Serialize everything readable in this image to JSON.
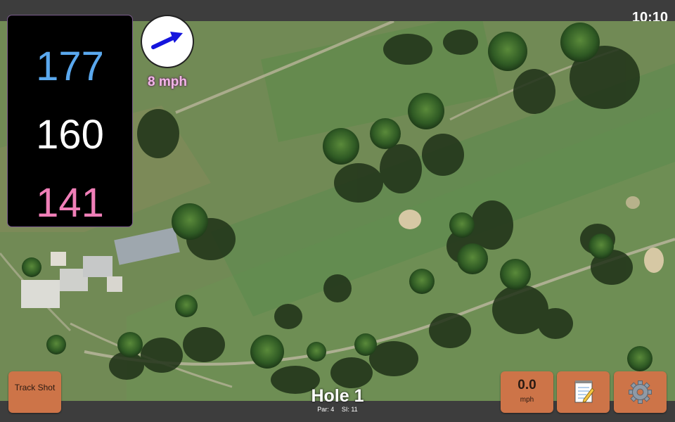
{
  "status_bar": {
    "time": "10:10"
  },
  "distances": {
    "back": "177",
    "middle": "160",
    "front": "141"
  },
  "wind": {
    "speed": "8 mph",
    "arrow_icon": "wind-arrow-icon",
    "arrow_color": "#1515dd"
  },
  "buttons": {
    "track_shot": "Track Shot",
    "speed_value": "0.0",
    "speed_unit": "mph",
    "notes_icon": "notepad-icon",
    "settings_icon": "gear-icon",
    "button_color": "#cd7448"
  },
  "hole": {
    "title": "Hole 1",
    "par": "Par: 4",
    "si": "SI: 11"
  },
  "colors": {
    "back": "#5aa8ee",
    "middle": "#ffffff",
    "front": "#f07fb8",
    "wind_text": "#f3b6e8"
  }
}
